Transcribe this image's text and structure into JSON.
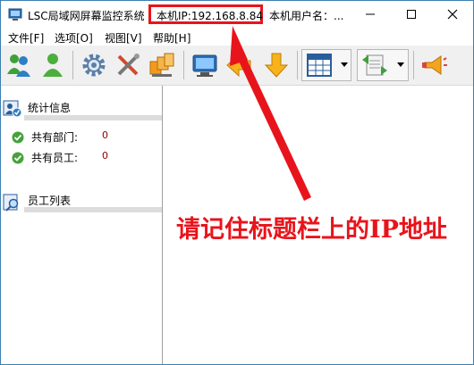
{
  "window": {
    "title": "LSC局域网屏幕监控系统",
    "ip_label": "本机IP:192.168.8.84",
    "user_label": "本机用户名：..."
  },
  "window_buttons": {
    "minimize": "minimize-icon",
    "maximize": "maximize-icon",
    "close": "close-icon"
  },
  "menu": {
    "items": [
      {
        "label": "文件[F]"
      },
      {
        "label": "选项[O]"
      },
      {
        "label": "视图[V]"
      },
      {
        "label": "帮助[H]"
      }
    ]
  },
  "toolbar": {
    "icons": [
      "users-icon",
      "user-add-icon",
      "settings-gear-icon",
      "tools-icon",
      "network-computers-icon",
      "monitor-icon",
      "arrow-left-icon",
      "arrow-down-icon",
      "grid-layout-icon",
      "transfer-icon",
      "broadcast-icon"
    ]
  },
  "sidebar": {
    "stats": {
      "title": "统计信息",
      "rows": [
        {
          "label": "共有部门:",
          "value": "0"
        },
        {
          "label": "共有员工:",
          "value": "0"
        }
      ]
    },
    "employees": {
      "title": "员工列表"
    }
  },
  "annotation": {
    "text": "请记住标题栏上的IP地址",
    "color": "#e8141b"
  }
}
